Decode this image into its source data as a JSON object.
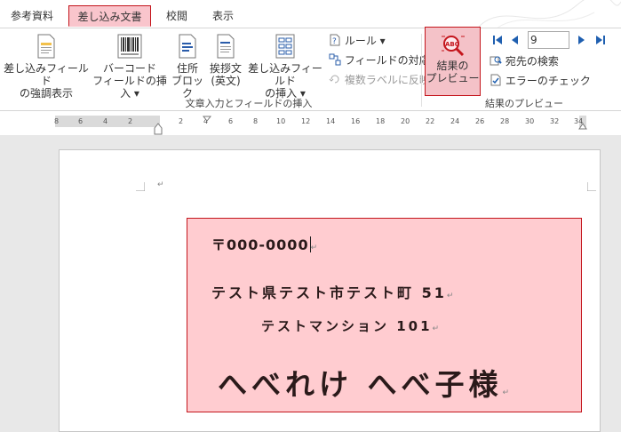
{
  "tabs": [
    {
      "label": "参考資料",
      "active": false
    },
    {
      "label": "差し込み文書",
      "active": true
    },
    {
      "label": "校閲",
      "active": false
    },
    {
      "label": "表示",
      "active": false
    }
  ],
  "ribbon": {
    "highlight_fields": {
      "line1": "差し込みフィールド",
      "line2": "の強調表示"
    },
    "barcode": {
      "line1": "バーコード",
      "line2": "フィールドの挿入 ▾"
    },
    "address_block": {
      "line1": "住所",
      "line2": "ブロック"
    },
    "greeting": {
      "line1": "挨拶文",
      "line2": "(英文)"
    },
    "insert_field": {
      "line1": "差し込みフィールド",
      "line2": "の挿入 ▾"
    },
    "rules": "ルール ▾",
    "match_fields": "フィールドの対応",
    "update_labels": "複数ラベルに反映",
    "group_write_insert": "文章入力とフィールドの挿入",
    "preview_results": {
      "line1": "結果の",
      "line2": "プレビュー"
    },
    "record_number": "9",
    "find_recipient": "宛先の検索",
    "check_errors": "エラーのチェック",
    "group_preview": "結果のプレビュー"
  },
  "ruler": {
    "ticks": [
      "8",
      "6",
      "4",
      "2",
      "2",
      "4",
      "6",
      "8",
      "10",
      "12",
      "14",
      "16",
      "18",
      "20",
      "22",
      "24",
      "26",
      "28",
      "30",
      "32",
      "34"
    ]
  },
  "label": {
    "postal": "〒000-0000",
    "address1": "テスト県テスト市テスト町 51",
    "address2": "テストマンション 101",
    "name": "へべれけ へべ子様"
  },
  "colors": {
    "accent": "#c4151c",
    "highlight": "#ffccd0",
    "nav_blue": "#1f5fb0"
  }
}
